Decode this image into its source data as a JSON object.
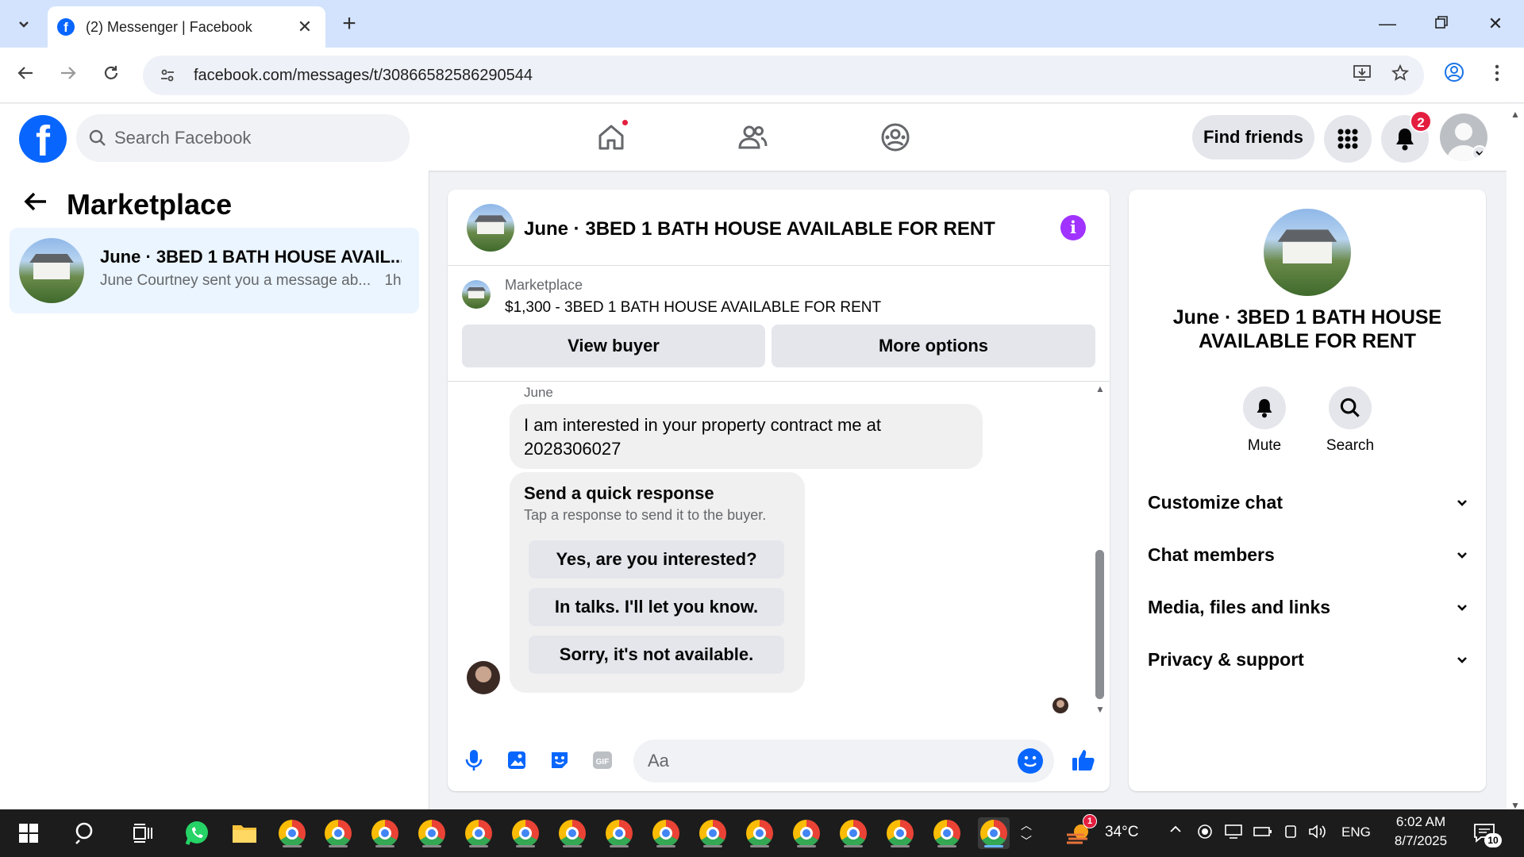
{
  "browser": {
    "tab_title": "(2) Messenger | Facebook",
    "url": "facebook.com/messages/t/30866582586290544"
  },
  "fb": {
    "search_placeholder": "Search Facebook",
    "find_friends": "Find friends",
    "notification_count": "2"
  },
  "sidebar": {
    "title": "Marketplace",
    "conversations": [
      {
        "name": "June · 3BED 1 BATH HOUSE AVAIL...",
        "preview": "June Courtney sent you a message ab...",
        "time": "1h"
      }
    ]
  },
  "chat": {
    "title": "June · 3BED 1 BATH HOUSE AVAILABLE FOR RENT",
    "marketplace_label": "Marketplace",
    "listing": "$1,300 - 3BED 1 BATH HOUSE AVAILABLE FOR RENT",
    "view_buyer": "View buyer",
    "more_options": "More options",
    "sender": "June",
    "message_line1": "I am interested in your property contract me at",
    "message_line2": "2028306027",
    "quick_title": "Send a quick response",
    "quick_sub": "Tap a response to send it to the buyer.",
    "quick_options": [
      "Yes, are you interested?",
      "In talks. I'll let you know.",
      "Sorry, it's not available."
    ],
    "input_placeholder": "Aa"
  },
  "details": {
    "title_line1": "June · 3BED 1 BATH HOUSE",
    "title_line2": "AVAILABLE FOR RENT",
    "mute": "Mute",
    "search": "Search",
    "sections": [
      "Customize chat",
      "Chat members",
      "Media, files and links",
      "Privacy & support"
    ]
  },
  "taskbar": {
    "weather_badge": "1",
    "temperature": "34°C",
    "language": "ENG",
    "time": "6:02 AM",
    "date": "8/7/2025",
    "notif_count": "10"
  },
  "colors": {
    "fb_blue": "#0866ff",
    "selected_bg": "#ebf5ff",
    "info_purple": "#a033ff",
    "badge_red": "#e41e3f"
  }
}
